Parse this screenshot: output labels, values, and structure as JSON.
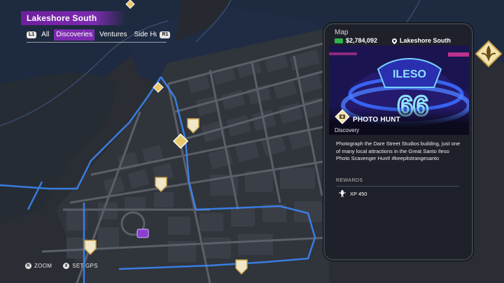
{
  "region": {
    "title": "Lakeshore South"
  },
  "filters": {
    "left_button": "L1",
    "right_button": "R1",
    "tabs": [
      {
        "label": "All",
        "active": false
      },
      {
        "label": "Discoveries",
        "active": true
      },
      {
        "label": "Ventures",
        "active": false
      },
      {
        "label": "Side Hu",
        "active": false
      }
    ]
  },
  "hints": {
    "zoom_button": "R",
    "zoom_label": "ZOOM",
    "gps_button": "X",
    "gps_label": "SET GPS"
  },
  "phone": {
    "app_title": "Map",
    "cash": "$2,784,092",
    "location": "Lakeshore South",
    "activity_title": "PHOTO HUNT",
    "activity_type": "Discovery",
    "description": "Photograph the Dare Street Studios building, just one of many local attractions in the Great Santo Ileso Photo Scavenger Hunt! #keepitstrangesanto",
    "rewards_label": "REWARDS",
    "reward_value": "XP 450",
    "sign_text_top": "ILESO",
    "sign_text_main": "66"
  },
  "colors": {
    "accent_purple": "#7c2bb0",
    "route_blue": "#3b8bff",
    "marker_gold": "#e8c86a",
    "cash_green": "#2fb34a"
  }
}
